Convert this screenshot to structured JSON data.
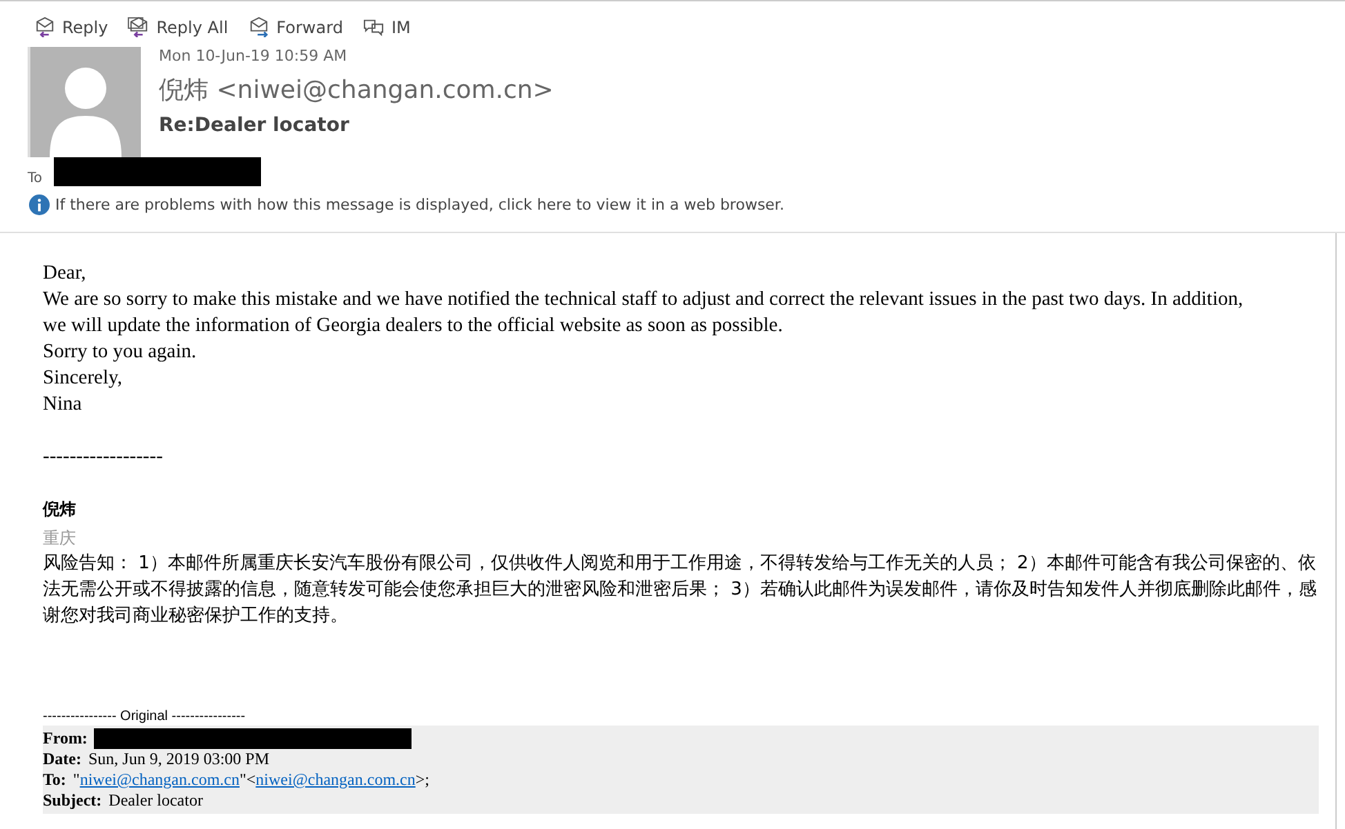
{
  "toolbar": [
    {
      "label": "Reply",
      "kind": "reply"
    },
    {
      "label": "Reply All",
      "kind": "reply-all"
    },
    {
      "label": "Forward",
      "kind": "forward"
    },
    {
      "label": "IM",
      "kind": "im"
    }
  ],
  "header": {
    "date": "Mon 10-Jun-19 10:59 AM",
    "sender": "倪炜 <niwei@changan.com.cn>",
    "subject": "Re:Dealer locator",
    "to_label": "To",
    "info": "If there are problems with how this message is displayed, click here to view it in a web browser."
  },
  "body": {
    "lines": [
      "Dear,",
      "We are so sorry to make this mistake and we have notified the technical staff to adjust and correct the relevant issues in the past two days. In addition, we will update the information of Georgia dealers to the official website as soon as possible.",
      "Sorry to you again.",
      "Sincerely,",
      "Nina"
    ],
    "rule": "------------------",
    "signature_name": "倪炜",
    "signature_city": "重庆",
    "notice": "风险告知： 1）本邮件所属重庆长安汽车股份有限公司，仅供收件人阅览和用于工作用途，不得转发给与工作无关的人员； 2）本邮件可能含有我公司保密的、依法无需公开或不得披露的信息，随意转发可能会使您承担巨大的泄密风险和泄密后果； 3）若确认此邮件为误发邮件，请你及时告知发件人并彻底删除此邮件，感谢您对我司商业秘密保护工作的支持。"
  },
  "original": {
    "separator": "---------------- Original ----------------",
    "fields": [
      {
        "label": "From:",
        "redacted": true
      },
      {
        "label": "Date:",
        "value": "Sun, Jun 9, 2019 03:00 PM"
      },
      {
        "label": "To:",
        "parts": [
          {
            "kind": "text",
            "text": "\""
          },
          {
            "kind": "link",
            "text": "niwei@changan.com.cn"
          },
          {
            "kind": "text",
            "text": "\"<"
          },
          {
            "kind": "link",
            "text": "niwei@changan.com.cn"
          },
          {
            "kind": "text",
            "text": ">;"
          }
        ]
      },
      {
        "label": "Subject:",
        "value": "Dealer locator"
      }
    ]
  }
}
